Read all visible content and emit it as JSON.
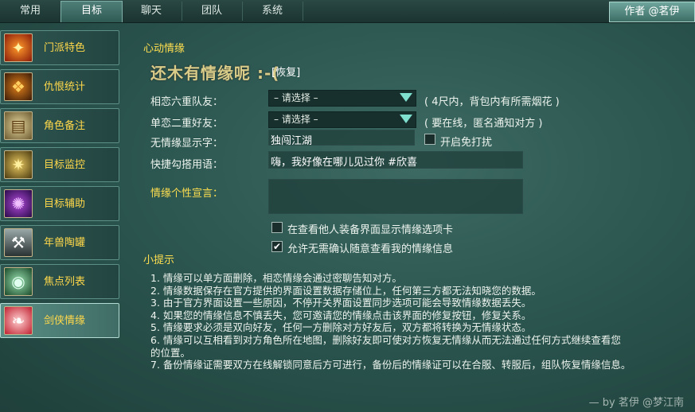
{
  "tabs": [
    "常用",
    "目标",
    "聊天",
    "团队",
    "系统"
  ],
  "author_button": "作者 @茗伊",
  "sidebar": {
    "items": [
      {
        "label": "门派特色",
        "icon": "flame-icon"
      },
      {
        "label": "仇恨统计",
        "icon": "dragon-icon"
      },
      {
        "label": "角色备注",
        "icon": "book-icon"
      },
      {
        "label": "目标监控",
        "icon": "emblem-icon"
      },
      {
        "label": "目标辅助",
        "icon": "magic-icon"
      },
      {
        "label": "年兽陶罐",
        "icon": "hammer-icon"
      },
      {
        "label": "焦点列表",
        "icon": "eye-icon"
      },
      {
        "label": "剑侠情缘",
        "icon": "heart-icon"
      }
    ],
    "active_index": 7
  },
  "main": {
    "section_title": "心动情缘",
    "status_text": "还木有情缘呢 :-(",
    "restore_link": "[恢复]",
    "six_label": "相恋六重队友：",
    "six_select": "– 请选择 –",
    "six_hint": "( 4尺内，背包内有所需烟花 )",
    "two_label": "单恋二重好友：",
    "two_select": "– 请选择 –",
    "two_hint": "( 要在线，匿名通知对方 )",
    "noname_label": "无情缘显示字：",
    "noname_value": "独闯江湖",
    "dnd_label": "开启免打扰",
    "quick_label": "快捷勾搭用语：",
    "quick_value": "嗨，我好像在哪儿见过你 #欣喜",
    "decl_label": "情缘个性宣言：",
    "opt1_label": "在查看他人装备界面显示情缘选项卡",
    "opt1_checked": false,
    "opt2_label": "允许无需确认随意查看我的情缘信息",
    "opt2_checked": true,
    "tips_title": "小提示",
    "tips": [
      "1. 情缘可以单方面删除，相恋情缘会通过密聊告知对方。",
      "2. 情缘数据保存在官方提供的界面设置数据存储位上，任何第三方都无法知晓您的数据。",
      "3. 由于官方界面设置一些原因，不停开关界面设置同步选项可能会导致情缘数据丢失。",
      "4. 如果您的情缘信息不慎丢失，您可邀请您的情缘点击该界面的修复按钮，修复关系。",
      "5. 情缘要求必须是双向好友，任何一方删除对方好友后，双方都将转换为无情缘状态。",
      "6. 情缘可以互相看到对方角色所在地图，删除好友即可使对方恢复无情缘从而无法通过任何方式继续查看您",
      "的位置。",
      "7. 备份情缘证需要双方在线解锁同意后方可进行，备份后的情缘证可以在合服、转服后，组队恢复情缘信息。"
    ]
  },
  "signature": "— by 茗伊 @梦江南",
  "colors": {
    "accent_yellow": "#ffdf4f",
    "label": "#eef4ee",
    "select_arrow": "#7fe0d0"
  }
}
